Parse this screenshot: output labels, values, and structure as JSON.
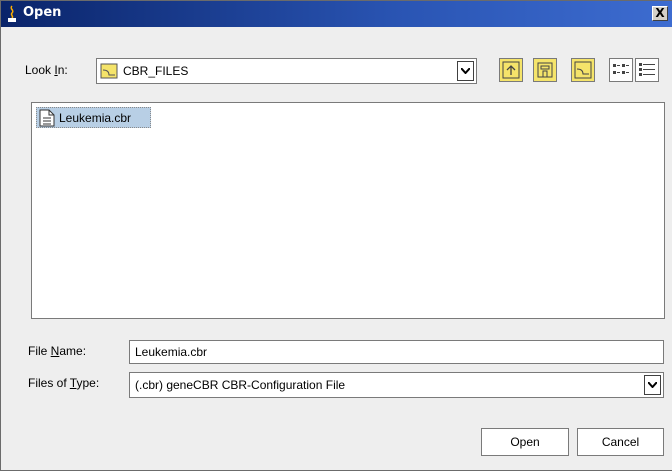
{
  "window": {
    "title": "Open",
    "close_label": "X"
  },
  "lookin": {
    "label_pre": "Look ",
    "label_mn": "I",
    "label_post": "n:",
    "value": "CBR_FILES"
  },
  "toolbar": {
    "icons": [
      "up-one-level-icon",
      "home-icon",
      "new-folder-icon",
      "list-view-icon",
      "details-view-icon"
    ]
  },
  "files": [
    {
      "name": "Leukemia.cbr"
    }
  ],
  "file_name": {
    "label_pre": "File ",
    "label_mn": "N",
    "label_post": "ame:",
    "value": "Leukemia.cbr"
  },
  "files_of_type": {
    "label_pre": "Files of ",
    "label_mn": "T",
    "label_post": "ype:",
    "value": "(.cbr) geneCBR CBR-Configuration File"
  },
  "buttons": {
    "open": "Open",
    "cancel": "Cancel"
  },
  "colors": {
    "titlebar": "#0a246a",
    "icon_yellow": "#f5e46a",
    "selection": "#b8cfe5"
  }
}
